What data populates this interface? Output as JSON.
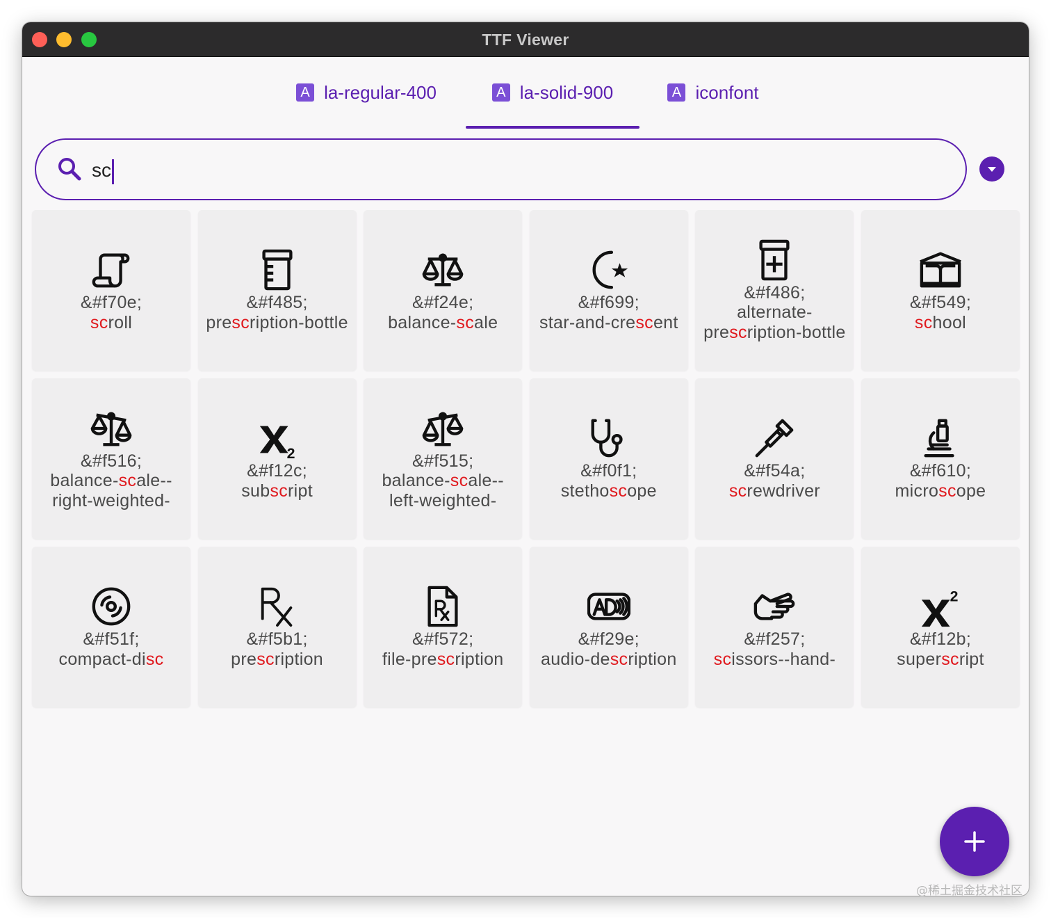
{
  "window": {
    "title": "TTF Viewer"
  },
  "tabs": [
    {
      "label": "la-regular-400",
      "icon": "font-file-icon",
      "active": false
    },
    {
      "label": "la-solid-900",
      "icon": "font-file-icon",
      "active": true
    },
    {
      "label": "iconfont",
      "icon": "font-file-icon",
      "active": false
    }
  ],
  "tab_icon_glyph": "A",
  "search": {
    "value": "sc",
    "highlight": "sc"
  },
  "colors": {
    "accent": "#5b1fb0",
    "highlight": "#e0191e",
    "card_bg": "#efeeef",
    "text": "#4a4a4a"
  },
  "icons": [
    {
      "code": "&#f70e;",
      "name": "scroll",
      "icon": "scroll-icon"
    },
    {
      "code": "&#f485;",
      "name": "prescription-bottle",
      "icon": "prescription-bottle-icon"
    },
    {
      "code": "&#f24e;",
      "name": "balance-scale",
      "icon": "balance-scale-icon"
    },
    {
      "code": "&#f699;",
      "name": "star-and-crescent",
      "icon": "star-and-crescent-icon"
    },
    {
      "code": "&#f486;",
      "name": "alternate-prescription-bottle",
      "icon": "prescription-bottle-alt-icon"
    },
    {
      "code": "&#f549;",
      "name": "school",
      "icon": "school-icon"
    },
    {
      "code": "&#f516;",
      "name": "balance-scale--right-weighted-",
      "icon": "balance-scale-right-icon"
    },
    {
      "code": "&#f12c;",
      "name": "subscript",
      "icon": "subscript-icon"
    },
    {
      "code": "&#f515;",
      "name": "balance-scale--left-weighted-",
      "icon": "balance-scale-left-icon"
    },
    {
      "code": "&#f0f1;",
      "name": "stethoscope",
      "icon": "stethoscope-icon"
    },
    {
      "code": "&#f54a;",
      "name": "screwdriver",
      "icon": "screwdriver-icon"
    },
    {
      "code": "&#f610;",
      "name": "microscope",
      "icon": "microscope-icon"
    },
    {
      "code": "&#f51f;",
      "name": "compact-disc",
      "icon": "compact-disc-icon"
    },
    {
      "code": "&#f5b1;",
      "name": "prescription",
      "icon": "prescription-icon"
    },
    {
      "code": "&#f572;",
      "name": "file-prescription",
      "icon": "file-prescription-icon"
    },
    {
      "code": "&#f29e;",
      "name": "audio-description",
      "icon": "audio-description-icon"
    },
    {
      "code": "&#f257;",
      "name": "scissors--hand-",
      "icon": "hand-scissors-icon"
    },
    {
      "code": "&#f12b;",
      "name": "superscript",
      "icon": "superscript-icon"
    }
  ],
  "fab": {
    "icon": "plus-icon"
  },
  "watermark": "@稀土掘金技术社区"
}
